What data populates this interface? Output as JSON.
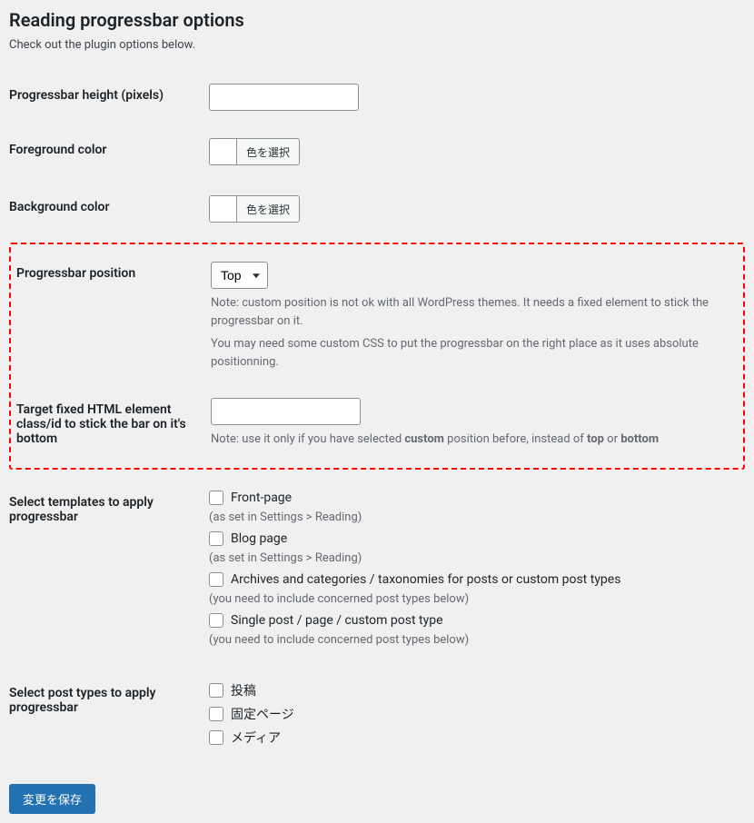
{
  "title": "Reading progressbar options",
  "subtitle": "Check out the plugin options below.",
  "fields": {
    "height": {
      "label": "Progressbar height (pixels)",
      "value": ""
    },
    "foreground": {
      "label": "Foreground color",
      "button": "色を選択"
    },
    "background": {
      "label": "Background color",
      "button": "色を選択"
    },
    "position": {
      "label": "Progressbar position",
      "selected": "Top",
      "note1": "Note: custom position is not ok with all WordPress themes. It needs a fixed element to stick the progressbar on it.",
      "note2": "You may need some custom CSS to put the progressbar on the right place as it uses absolute positionning."
    },
    "target": {
      "label": "Target fixed HTML element class/id to stick the bar on it's bottom",
      "value": "",
      "note_pre": "Note: use it only if you have selected ",
      "note_custom": "custom",
      "note_mid": " position before, instead of ",
      "note_top": "top",
      "note_or": " or ",
      "note_bottom": "bottom"
    },
    "templates": {
      "label": "Select templates to apply progressbar",
      "items": [
        {
          "label": "Front-page",
          "note": "(as set in Settings > Reading)"
        },
        {
          "label": "Blog page",
          "note": "(as set in Settings > Reading)"
        },
        {
          "label": "Archives and categories / taxonomies for posts or custom post types",
          "note": "(you need to include concerned post types below)"
        },
        {
          "label": "Single post / page / custom post type",
          "note": "(you need to include concerned post types below)"
        }
      ]
    },
    "posttypes": {
      "label": "Select post types to apply progressbar",
      "items": [
        {
          "label": "投稿"
        },
        {
          "label": "固定ページ"
        },
        {
          "label": "メディア"
        }
      ]
    }
  },
  "submit": "変更を保存"
}
